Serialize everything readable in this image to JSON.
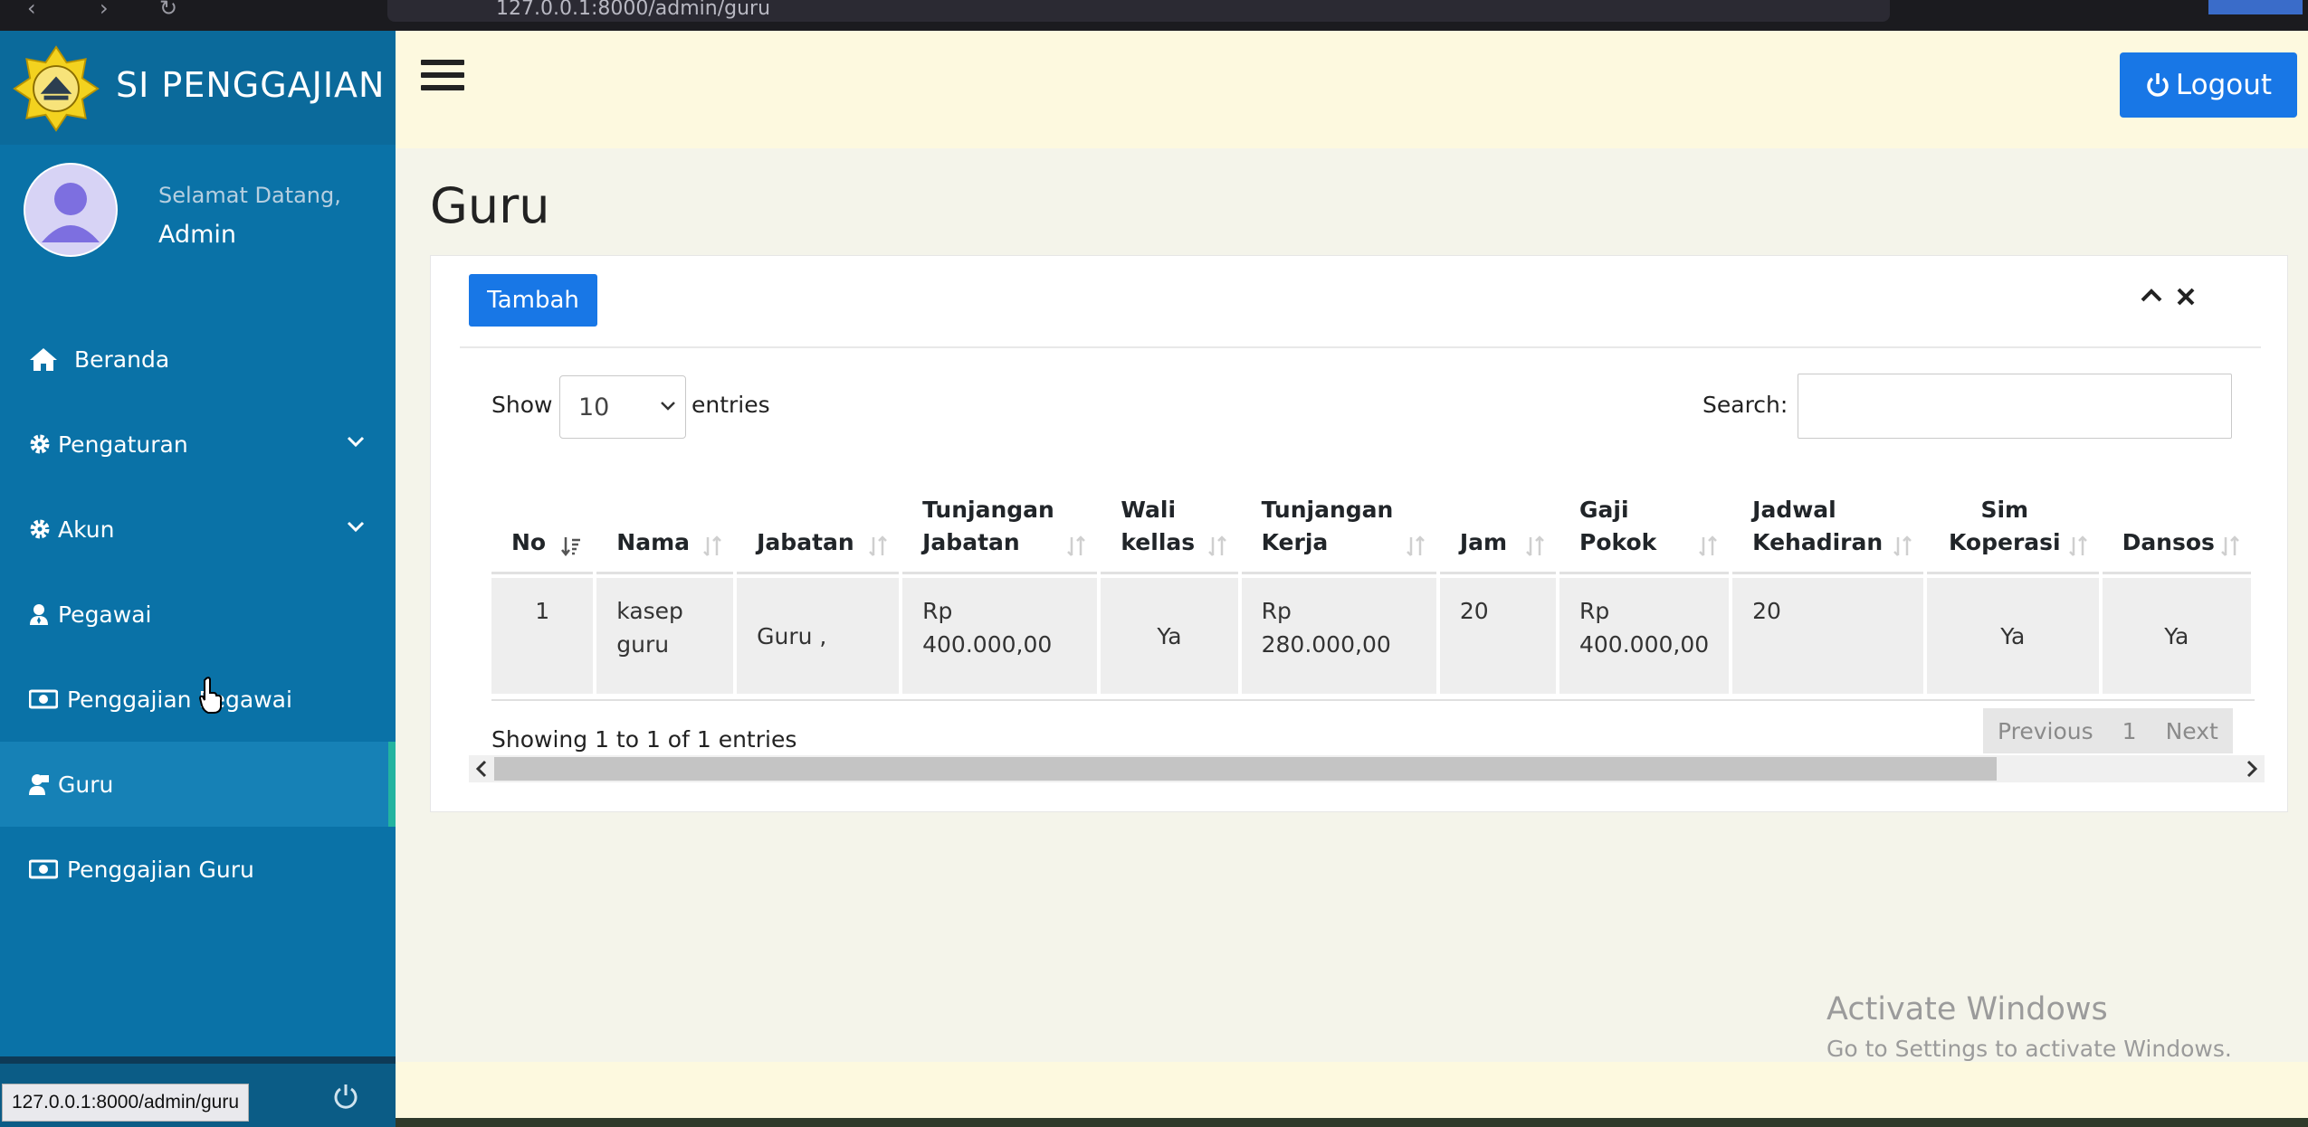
{
  "browser": {
    "url": "127.0.0.1:8000/admin/guru"
  },
  "sidebar": {
    "brand": "SI PENGGAJIAN",
    "welcome": "Selamat Datang,",
    "username": "Admin",
    "items": [
      {
        "label": "Beranda",
        "icon": "home-icon"
      },
      {
        "label": "Pengaturan",
        "icon": "gear-icon",
        "has_caret": true
      },
      {
        "label": "Akun",
        "icon": "gear-icon",
        "has_caret": true
      },
      {
        "label": "Pegawai",
        "icon": "user-tie-icon"
      },
      {
        "label": "Penggajian Pegawai",
        "icon": "money-icon"
      },
      {
        "label": "Guru",
        "icon": "teacher-icon",
        "active": true
      },
      {
        "label": "Penggajian Guru",
        "icon": "money-icon"
      }
    ],
    "status_url": "127.0.0.1:8000/admin/guru"
  },
  "topbar": {
    "logout_label": "Logout"
  },
  "page": {
    "title": "Guru"
  },
  "card": {
    "add_label": "Tambah",
    "show_label": "Show",
    "length_value": "10",
    "entries_label": "entries",
    "search_label": "Search:",
    "search_value": "",
    "info": "Showing 1 to 1 of 1 entries",
    "pagination": {
      "previous": "Previous",
      "current": "1",
      "next": "Next"
    }
  },
  "table": {
    "headers": [
      {
        "line1": "",
        "line2": "No"
      },
      {
        "line1": "",
        "line2": "Nama"
      },
      {
        "line1": "",
        "line2": "Jabatan"
      },
      {
        "line1": "Tunjangan",
        "line2": "Jabatan"
      },
      {
        "line1": "Wali",
        "line2": "kellas"
      },
      {
        "line1": "Tunjangan",
        "line2": "Kerja"
      },
      {
        "line1": "",
        "line2": "Jam"
      },
      {
        "line1": "Gaji",
        "line2": "Pokok"
      },
      {
        "line1": "Jadwal",
        "line2": "Kehadiran"
      },
      {
        "line1": "Sim",
        "line2": "Koperasi"
      },
      {
        "line1": "",
        "line2": "Dansos"
      }
    ],
    "rows": [
      {
        "no": "1",
        "nama_1": "kasep",
        "nama_2": "guru",
        "jabatan": "Guru ,",
        "tunjangan_jabatan_1": "Rp",
        "tunjangan_jabatan_2": "400.000,00",
        "wali_kelas": "Ya",
        "tunjangan_kerja_1": "Rp",
        "tunjangan_kerja_2": "280.000,00",
        "jam": "20",
        "gaji_pokok_1": "Rp",
        "gaji_pokok_2": "400.000,00",
        "jadwal_kehadiran": "20",
        "sim_koperasi": "Ya",
        "dansos": "Ya"
      }
    ]
  },
  "watermark": {
    "line1": "Activate Windows",
    "line2": "Go to Settings to activate Windows."
  },
  "colors": {
    "sidebar": "#0a72a7",
    "primary_button": "#1877e6",
    "topbar": "#fdf9df",
    "content_bg": "#f4f4ea"
  }
}
